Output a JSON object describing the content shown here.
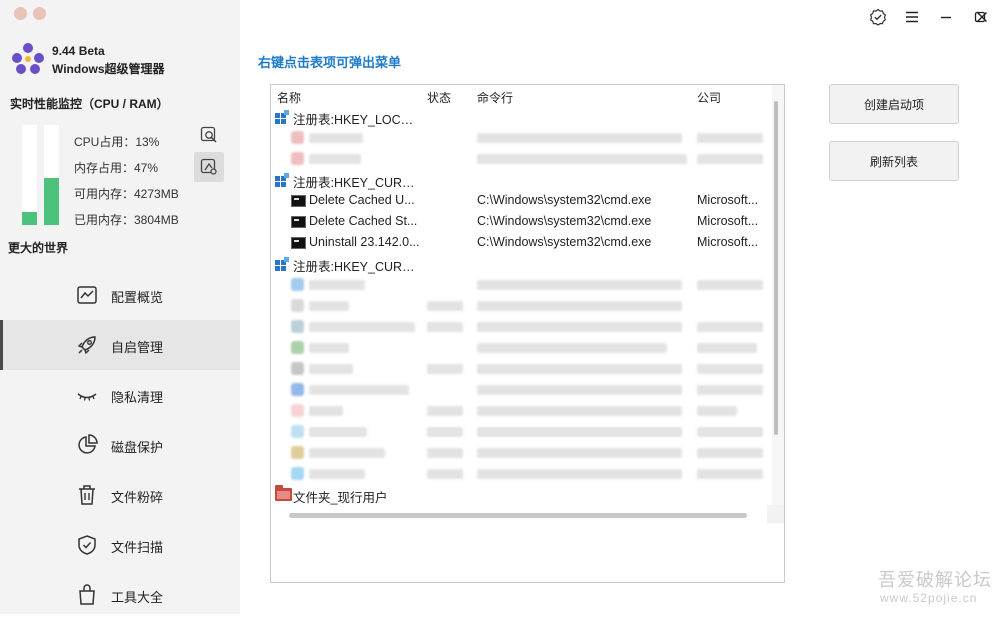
{
  "app": {
    "version": "9.44 Beta",
    "name": "Windows超级管理器"
  },
  "monitor": {
    "title": "实时性能监控（CPU / RAM）",
    "cpu_label": "CPU占用：13%",
    "mem_label": "内存占用：47%",
    "avail_label": "可用内存：4273MB",
    "used_label": "已用内存：3804MB",
    "cpu_percent": 13,
    "mem_percent": 47,
    "slogan": "更大的世界"
  },
  "nav": {
    "items": [
      {
        "label": "配置概览",
        "icon": "chart-icon"
      },
      {
        "label": "自启管理",
        "icon": "rocket-icon"
      },
      {
        "label": "隐私清理",
        "icon": "eye-closed-icon"
      },
      {
        "label": "磁盘保护",
        "icon": "pie-chart-icon"
      },
      {
        "label": "文件粉碎",
        "icon": "trash-icon"
      },
      {
        "label": "文件扫描",
        "icon": "shield-check-icon"
      },
      {
        "label": "工具大全",
        "icon": "bag-icon"
      }
    ],
    "active_index": 1
  },
  "main": {
    "heading": "右键点击表项可弹出菜单",
    "columns": {
      "name": "名称",
      "status": "状态",
      "command": "命令行",
      "company": "公司"
    },
    "groups": {
      "g1": "注册表:HKEY_LOCAL...",
      "g2": "注册表:HKEY_CURRE...",
      "g3": "注册表:HKEY_CURRE...",
      "folder": "文件夹_现行用户"
    },
    "rows": [
      {
        "name": "Delete Cached U...",
        "command": "C:\\Windows\\system32\\cmd.exe",
        "company": "Microsoft..."
      },
      {
        "name": "Delete Cached St...",
        "command": "C:\\Windows\\system32\\cmd.exe",
        "company": "Microsoft..."
      },
      {
        "name": "Uninstall 23.142.0...",
        "command": "C:\\Windows\\system32\\cmd.exe",
        "company": "Microsoft..."
      }
    ],
    "buttons": {
      "create": "创建启动项",
      "refresh": "刷新列表"
    }
  },
  "colors": {
    "accent_blue": "#1e7acb",
    "bar_green": "#4cc27c",
    "logo_purple": "#6a4fc7"
  },
  "watermark": {
    "line1": "吾爱破解论坛",
    "line2": "www.52pojie.cn"
  }
}
